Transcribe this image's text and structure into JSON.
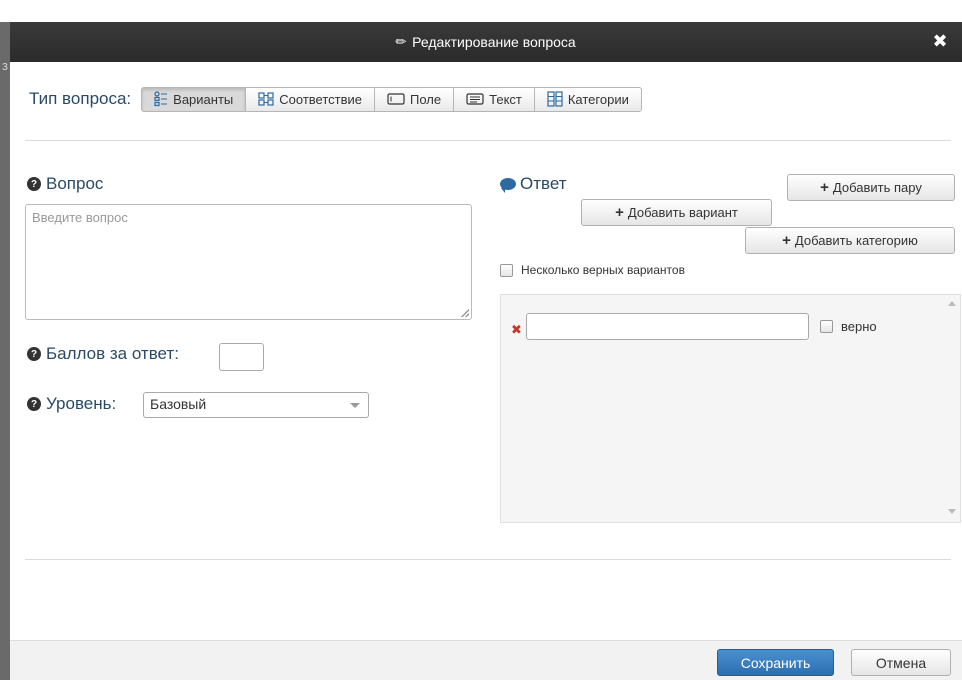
{
  "dialog": {
    "title": "Редактирование вопроса"
  },
  "backdrop": {
    "glyph": "з"
  },
  "question_type": {
    "label": "Тип вопроса:",
    "options": [
      {
        "label": "Варианты",
        "icon": "list-options-icon",
        "active": true
      },
      {
        "label": "Соответствие",
        "icon": "match-grid-icon",
        "active": false
      },
      {
        "label": "Поле",
        "icon": "field-input-icon",
        "active": false
      },
      {
        "label": "Текст",
        "icon": "text-block-icon",
        "active": false
      },
      {
        "label": "Категории",
        "icon": "categories-icon",
        "active": false
      }
    ]
  },
  "question": {
    "label": "Вопрос",
    "placeholder": "Введите вопрос",
    "value": ""
  },
  "score": {
    "label": "Баллов за ответ:",
    "value": ""
  },
  "level": {
    "label": "Уровень:",
    "selected": "Базовый"
  },
  "answer": {
    "label": "Ответ",
    "add_pair": "Добавить пару",
    "add_variant": "Добавить вариант",
    "add_category": "Добавить категорию",
    "multiple_correct_label": "Несколько верных вариантов",
    "items": [
      {
        "value": "",
        "correct_label": "верно",
        "correct": false
      }
    ]
  },
  "footer": {
    "save": "Сохранить",
    "cancel": "Отмена"
  },
  "colors": {
    "header_bg": "#2b2b2b",
    "primary": "#2c6fb0",
    "label_text": "#2a4a66",
    "delete_x": "#c0392b"
  }
}
